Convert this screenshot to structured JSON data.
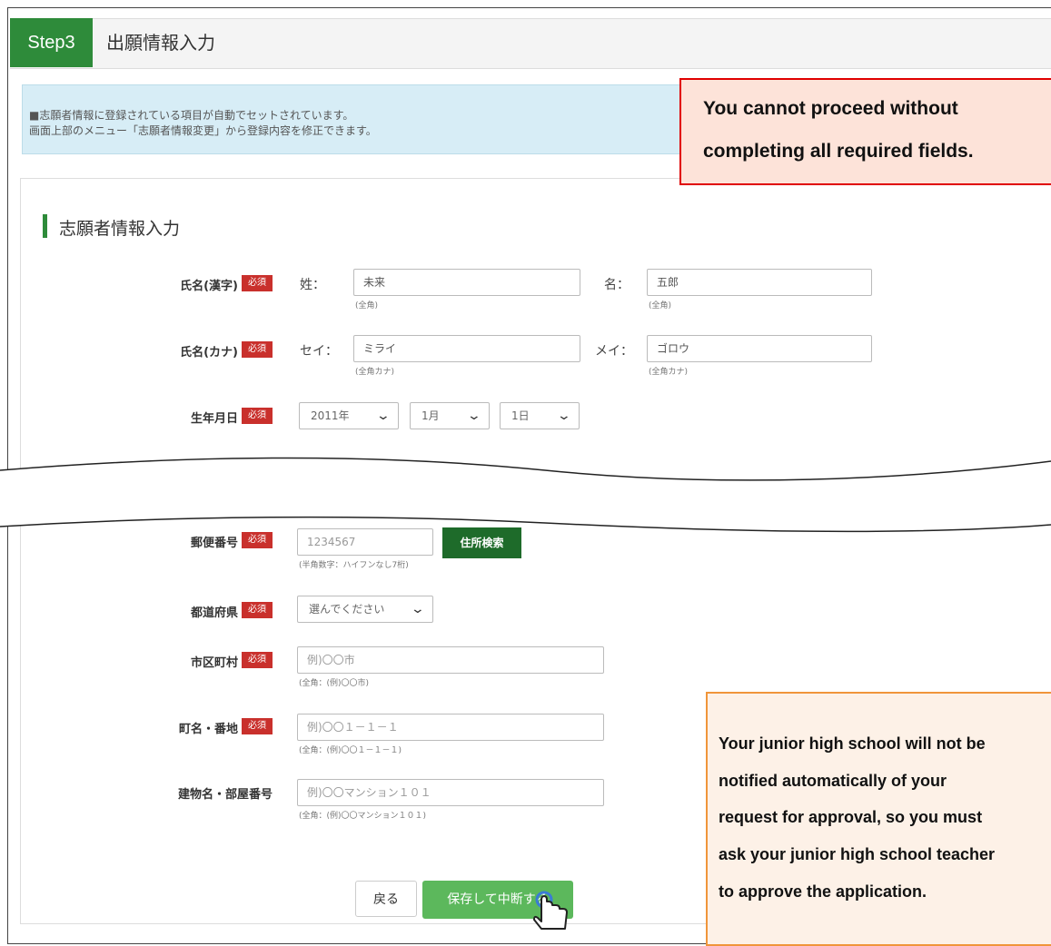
{
  "step": {
    "badge": "Step3",
    "title": "出願情報入力"
  },
  "info": {
    "line1": "■志願者情報に登録されている項目が自動でセットされています。",
    "line2": "画面上部のメニュー「志願者情報変更」から登録内容を修正できます。"
  },
  "section": {
    "title": "志願者情報入力"
  },
  "required_badge": "必須",
  "fields": {
    "name_kanji": {
      "label": "氏名(漢字)",
      "sei_label": "姓：",
      "sei_value": "未来",
      "mei_label": "名：",
      "mei_value": "五郎",
      "hint": "(全角)"
    },
    "name_kana": {
      "label": "氏名(カナ)",
      "sei_label": "セイ：",
      "sei_value": "ミライ",
      "mei_label": "メイ：",
      "mei_value": "ゴロウ",
      "hint": "(全角カナ)"
    },
    "birthdate": {
      "label": "生年月日",
      "year": "2011年",
      "month": "1月",
      "day": "1日"
    },
    "postal": {
      "label": "郵便番号",
      "placeholder": "1234567",
      "hint": "(半角数字：ハイフンなし7桁)",
      "search_button": "住所検索"
    },
    "prefecture": {
      "label": "都道府県",
      "value": "選んでください"
    },
    "city": {
      "label": "市区町村",
      "placeholder": "例)〇〇市",
      "hint": "(全角：(例)〇〇市)"
    },
    "town": {
      "label": "町名・番地",
      "placeholder": "例)〇〇１－１－１",
      "hint": "(全角：(例)〇〇１－１－１)"
    },
    "building": {
      "label": "建物名・部屋番号",
      "placeholder": "例)〇〇マンション１０１",
      "hint": "(全角：(例)〇〇マンション１０１)"
    }
  },
  "buttons": {
    "back": "戻る",
    "save": "保存して中断する"
  },
  "callouts": {
    "required": [
      "You cannot proceed without",
      "completing all required fields."
    ],
    "approval": [
      "Your junior high school will not be",
      "notified automatically of your",
      "request for approval, so you must",
      "ask your junior high school teacher",
      "to approve the application."
    ]
  },
  "colors": {
    "accent_green": "#2e8b3a",
    "required_red": "#c9302c",
    "info_blue": "#d7edf6",
    "save_green": "#5cb85c",
    "callout_red_border": "#e00000",
    "callout_orange_border": "#f0953a"
  }
}
